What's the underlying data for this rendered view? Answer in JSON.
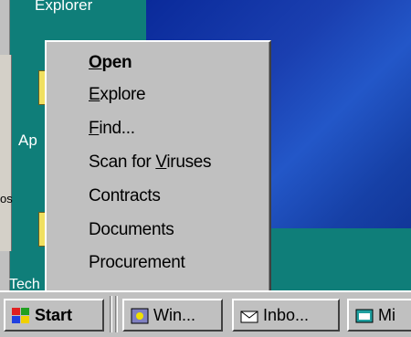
{
  "desktop": {
    "icons": [
      {
        "label": "Explorer"
      },
      {
        "label": "Ap"
      },
      {
        "label": "Tech"
      }
    ],
    "partial_window_text": "os"
  },
  "context_menu": {
    "items": [
      {
        "text_pre": "",
        "text_u": "O",
        "text_post": "pen",
        "bold": true
      },
      {
        "text_pre": "",
        "text_u": "E",
        "text_post": "xplore"
      },
      {
        "text_pre": "",
        "text_u": "F",
        "text_post": "ind..."
      },
      {
        "text_pre": "Scan for ",
        "text_u": "V",
        "text_post": "iruses"
      },
      {
        "text_pre": "Contracts",
        "text_u": "",
        "text_post": ""
      },
      {
        "text_pre": "Documents",
        "text_u": "",
        "text_post": ""
      },
      {
        "text_pre": "Procurement",
        "text_u": "",
        "text_post": ""
      }
    ]
  },
  "taskbar": {
    "start_label": "Start",
    "buttons": [
      {
        "label": "Win..."
      },
      {
        "label": "Inbo..."
      },
      {
        "label": "Mi"
      }
    ]
  }
}
